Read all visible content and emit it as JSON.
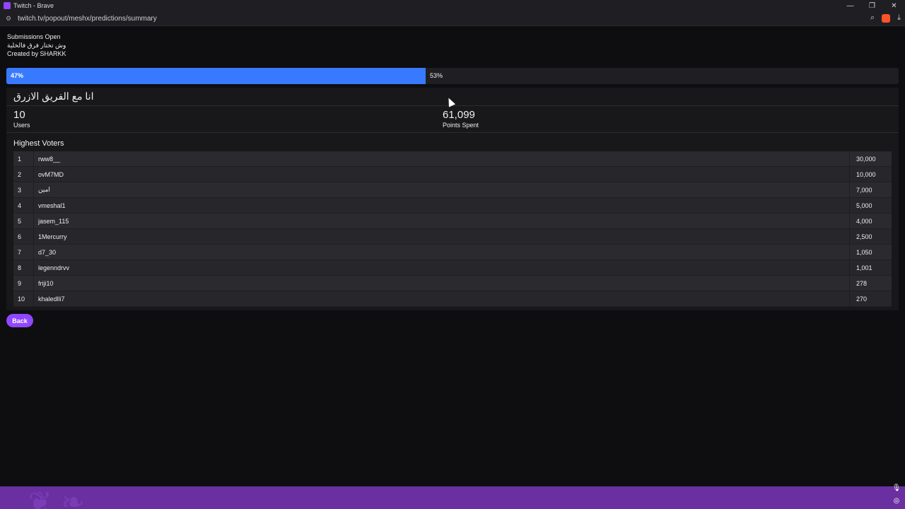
{
  "window": {
    "title": "Twitch - Brave",
    "controls": [
      "—",
      "❐",
      "✕"
    ]
  },
  "addressbar": {
    "url": "twitch.tv/popout/meshx/predictions/summary",
    "icons": [
      "search-icon",
      "brave-shield-icon",
      "download-icon"
    ]
  },
  "prediction": {
    "status": "Submissions Open",
    "question": "وش تختار فرق فالخلية",
    "created_by": "Created by SHARKK",
    "left_percent_label": "47%",
    "right_percent_label": "53%",
    "left_fraction": 0.47,
    "colors": {
      "blue": "#387aff",
      "purple": "#9147ff"
    }
  },
  "outcome": {
    "title": "انا مع الفريق الازرق",
    "users_value": "10",
    "users_label": "Users",
    "points_value": "61,099",
    "points_label": "Points Spent"
  },
  "voters": {
    "title": "Highest Voters",
    "rows": [
      {
        "rank": "1",
        "name": "rww8__",
        "points": "30,000"
      },
      {
        "rank": "2",
        "name": "ovM7MD",
        "points": "10,000"
      },
      {
        "rank": "3",
        "name": "امين",
        "points": "7,000"
      },
      {
        "rank": "4",
        "name": "vmeshal1",
        "points": "5,000"
      },
      {
        "rank": "5",
        "name": "jasem_115",
        "points": "4,000"
      },
      {
        "rank": "6",
        "name": "1Mercurry",
        "points": "2,500"
      },
      {
        "rank": "7",
        "name": "d7_30",
        "points": "1,050"
      },
      {
        "rank": "8",
        "name": "legenndrvv",
        "points": "1,001"
      },
      {
        "rank": "9",
        "name": "friji10",
        "points": "278"
      },
      {
        "rank": "10",
        "name": "khaledlli7",
        "points": "270"
      }
    ]
  },
  "back_label": "Back"
}
